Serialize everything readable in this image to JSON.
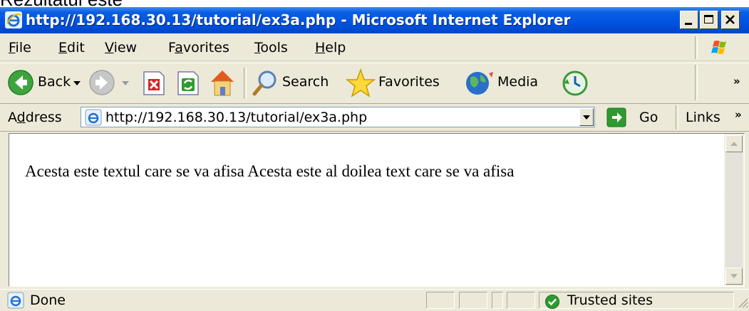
{
  "caption": "Rezultatul este",
  "window": {
    "title": "http://192.168.30.13/tutorial/ex3a.php - Microsoft Internet Explorer"
  },
  "menu": {
    "file": {
      "accel": "F",
      "rest": "ile"
    },
    "edit": {
      "accel": "E",
      "rest": "dit"
    },
    "view": {
      "accel": "V",
      "rest": "iew"
    },
    "favorites": {
      "pre": "F",
      "accel": "a",
      "rest": "vorites"
    },
    "tools": {
      "accel": "T",
      "rest": "ools"
    },
    "help": {
      "accel": "H",
      "rest": "elp"
    }
  },
  "toolbar": {
    "back_label": "Back",
    "search_label": "Search",
    "favorites_label": "Favorites",
    "media_label": "Media"
  },
  "address": {
    "label_pre": "A",
    "label_accel": "d",
    "label_rest": "dress",
    "url": "http://192.168.30.13/tutorial/ex3a.php",
    "go_label": "Go",
    "links_label": "Links"
  },
  "content": {
    "text": "Acesta este textul care se va afisa Acesta este al doilea text care se va afisa"
  },
  "status": {
    "text": "Done",
    "zone": "Trusted sites"
  },
  "colors": {
    "titlebar": "#0054e3",
    "chrome": "#ece9d8",
    "content_bg": "#ffffff"
  }
}
